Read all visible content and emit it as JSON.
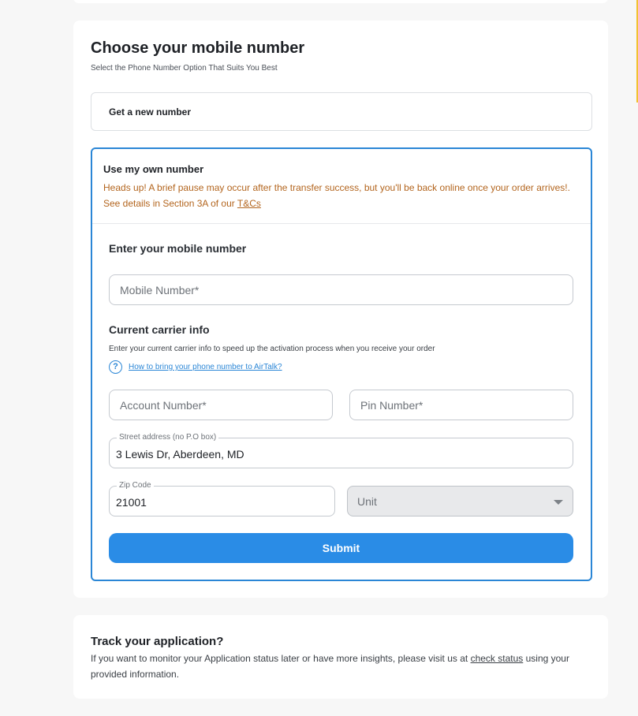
{
  "colors": {
    "accent": "#2a86d6",
    "submit": "#2a8ce6",
    "warning_text": "#b3651e",
    "page_bg": "#f7f7f7"
  },
  "choose": {
    "title": "Choose your mobile number",
    "subtitle": "Select the Phone Number Option That Suits You Best",
    "option_new_label": "Get a new number",
    "option_own_label": "Use my own number",
    "note_text": "Heads up! A brief pause may occur after the transfer success, but you'll be back online once your order arrives!. See details in Section 3A of our ",
    "note_link": "T&Cs"
  },
  "mobile": {
    "heading": "Enter your mobile number",
    "placeholder": "Mobile Number*"
  },
  "carrier": {
    "heading": "Current carrier info",
    "description": "Enter your current carrier info to speed up the activation process when you receive your order",
    "help_icon": "question-circle-icon",
    "help_link": "How to bring your phone number to AirTalk?",
    "account_placeholder": "Account Number*",
    "pin_placeholder": "Pin Number*"
  },
  "address": {
    "street_label": "Street address (no P.O box)",
    "street_value": "3 Lewis Dr, Aberdeen, MD",
    "zip_label": "Zip Code",
    "zip_value": "21001",
    "unit_value": "Unit"
  },
  "submit_label": "Submit",
  "track": {
    "title": "Track your application?",
    "text_before": "If you want to monitor your Application status later or have more insights, please visit us at ",
    "link": "check status",
    "text_after": " using your provided information."
  }
}
